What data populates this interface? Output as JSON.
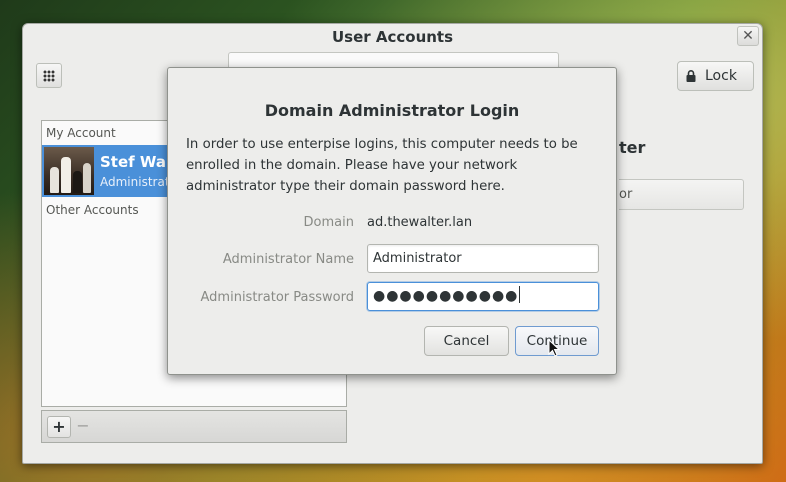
{
  "window": {
    "title": "User Accounts",
    "close_glyph": "✕",
    "lock_label": "Lock"
  },
  "accounts": {
    "my_account_header": "My Account",
    "selected": {
      "name": "Stef Walt",
      "role": "Administrato"
    },
    "other_accounts_header": "Other Accounts",
    "add_glyph": "+",
    "remove_glyph": "−"
  },
  "detail_fragments": {
    "title_fragment": "ter",
    "field_fragment": "or"
  },
  "dialog": {
    "title": "Domain Administrator Login",
    "message": "In order to use enterpise logins, this computer needs to be enrolled in the domain. Please have your network administrator type their domain password here.",
    "domain_label": "Domain",
    "domain_value": "ad.thewalter.lan",
    "admin_name_label": "Administrator Name",
    "admin_name_value": "Administrator",
    "admin_password_label": "Administrator Password",
    "admin_password_masked": "●●●●●●●●●●●",
    "cancel_label": "Cancel",
    "continue_label": "Continue"
  },
  "icons": {
    "grid": "grid-icon",
    "lock": "lock-icon",
    "close": "close-icon",
    "cursor": "mouse-pointer-icon"
  },
  "colors": {
    "selection": "#4a90d9",
    "window_bg": "#ededeb"
  }
}
